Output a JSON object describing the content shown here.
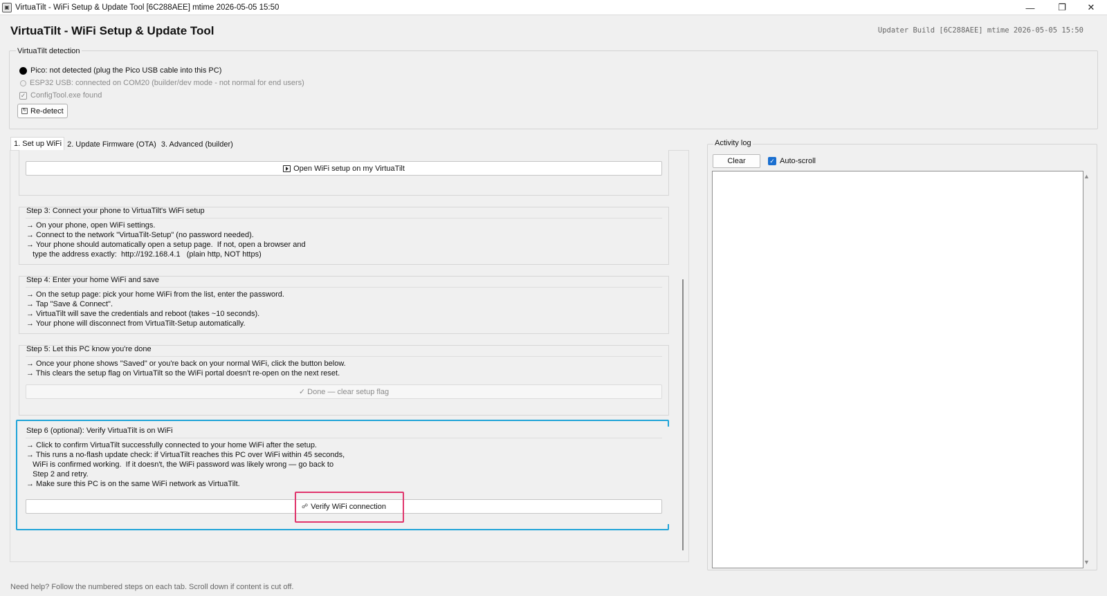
{
  "window": {
    "title": "VirtuaTilt - WiFi Setup & Update Tool  [6C288AEE] mtime 2026-05-05 15:50",
    "controls": {
      "minimize": "—",
      "maximize": "❐",
      "close": "✕"
    }
  },
  "header": {
    "title": "VirtuaTilt - WiFi Setup & Update Tool",
    "build": "Updater Build [6C288AEE] mtime 2026-05-05 15:50"
  },
  "detection": {
    "legend": "VirtuaTilt detection",
    "pico": "Pico: not detected  (plug the Pico USB cable into this PC)",
    "esp32": "ESP32 USB: connected on COM20  (builder/dev mode - not normal for end users)",
    "configtool": "ConfigTool.exe found",
    "redetect_label": "Re-detect"
  },
  "tabs": [
    {
      "label": "1. Set up WiFi"
    },
    {
      "label": "2. Update Firmware (OTA)"
    },
    {
      "label": "3. Advanced (builder)"
    }
  ],
  "steps": {
    "open_setup_label": "Open WiFi setup on my VirtuaTilt",
    "step3": {
      "title": "Step 3: Connect your phone to VirtuaTilt's WiFi setup",
      "lines": [
        "→ On your phone, open WiFi settings.",
        "→ Connect to the network \"VirtuaTilt-Setup\" (no password needed).",
        "→ Your phone should automatically open a setup page.  If not, open a browser and",
        "   type the address exactly:  http://192.168.4.1   (plain http, NOT https)"
      ]
    },
    "step4": {
      "title": "Step 4: Enter your home WiFi and save",
      "lines": [
        "→ On the setup page: pick your home WiFi from the list, enter the password.",
        "→ Tap \"Save & Connect\".",
        "→ VirtuaTilt will save the credentials and reboot (takes ~10 seconds).",
        "→ Your phone will disconnect from VirtuaTilt-Setup automatically."
      ]
    },
    "step5": {
      "title": "Step 5: Let this PC know you're done",
      "lines": [
        "→ Once your phone shows \"Saved\" or you're back on your normal WiFi, click the button below.",
        "→ This clears the setup flag on VirtuaTilt so the WiFi portal doesn't re-open on the next reset."
      ],
      "button_label": "✓ Done — clear setup flag"
    },
    "step6": {
      "title": "Step 6 (optional): Verify VirtuaTilt is on WiFi",
      "lines": [
        "→ Click to confirm VirtuaTilt successfully connected to your home WiFi after the setup.",
        "→ This runs a no-flash update check: if VirtuaTilt reaches this PC over WiFi within 45 seconds,",
        "   WiFi is confirmed working.  If it doesn't, the WiFi password was likely wrong — go back to",
        "   Step 2 and retry.",
        "→ Make sure this PC is on the same WiFi network as VirtuaTilt."
      ],
      "button_label": "Verify WiFi connection"
    }
  },
  "log": {
    "legend": "Activity log",
    "clear_label": "Clear",
    "autoscroll_label": "Auto-scroll"
  },
  "footer": {
    "hint": "Need help? Follow the numbered steps on each tab.  Scroll down if content is cut off."
  }
}
